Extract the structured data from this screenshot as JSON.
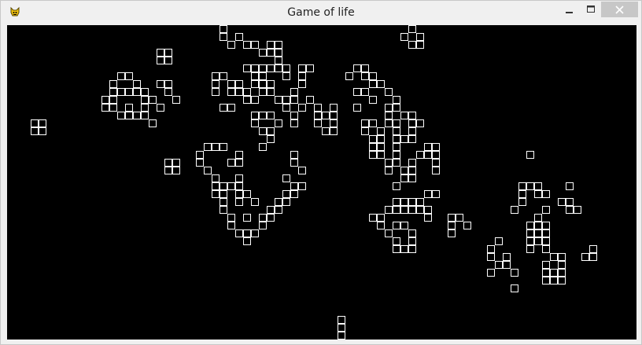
{
  "window": {
    "title": "Game of life",
    "icon": "pygame-snake-icon",
    "controls": [
      "minimize-icon",
      "maximize-icon",
      "close-icon"
    ]
  },
  "game": {
    "background_color": "#000000",
    "cell_color": "#ffffff",
    "cell_size": 10,
    "columns": 80,
    "rows": 40,
    "live_cells": [
      [
        27,
        0
      ],
      [
        51,
        0
      ],
      [
        27,
        1
      ],
      [
        29,
        1
      ],
      [
        50,
        1
      ],
      [
        52,
        1
      ],
      [
        28,
        2
      ],
      [
        30,
        2
      ],
      [
        31,
        2
      ],
      [
        33,
        2
      ],
      [
        34,
        2
      ],
      [
        51,
        2
      ],
      [
        52,
        2
      ],
      [
        19,
        3
      ],
      [
        20,
        3
      ],
      [
        32,
        3
      ],
      [
        33,
        3
      ],
      [
        34,
        3
      ],
      [
        19,
        4
      ],
      [
        20,
        4
      ],
      [
        34,
        4
      ],
      [
        33,
        5
      ],
      [
        34,
        5
      ],
      [
        30,
        5
      ],
      [
        31,
        5
      ],
      [
        32,
        5
      ],
      [
        35,
        5
      ],
      [
        37,
        5
      ],
      [
        38,
        5
      ],
      [
        44,
        5
      ],
      [
        45,
        5
      ],
      [
        14,
        6
      ],
      [
        15,
        6
      ],
      [
        26,
        6
      ],
      [
        27,
        6
      ],
      [
        31,
        6
      ],
      [
        32,
        6
      ],
      [
        35,
        6
      ],
      [
        37,
        6
      ],
      [
        43,
        6
      ],
      [
        45,
        6
      ],
      [
        46,
        6
      ],
      [
        13,
        7
      ],
      [
        16,
        7
      ],
      [
        19,
        7
      ],
      [
        20,
        7
      ],
      [
        26,
        7
      ],
      [
        28,
        7
      ],
      [
        29,
        7
      ],
      [
        31,
        7
      ],
      [
        32,
        7
      ],
      [
        33,
        7
      ],
      [
        37,
        7
      ],
      [
        46,
        7
      ],
      [
        47,
        7
      ],
      [
        13,
        8
      ],
      [
        14,
        8
      ],
      [
        15,
        8
      ],
      [
        16,
        8
      ],
      [
        17,
        8
      ],
      [
        20,
        8
      ],
      [
        26,
        8
      ],
      [
        28,
        8
      ],
      [
        29,
        8
      ],
      [
        30,
        8
      ],
      [
        32,
        8
      ],
      [
        33,
        8
      ],
      [
        36,
        8
      ],
      [
        44,
        8
      ],
      [
        45,
        8
      ],
      [
        48,
        8
      ],
      [
        12,
        9
      ],
      [
        13,
        9
      ],
      [
        17,
        9
      ],
      [
        18,
        9
      ],
      [
        21,
        9
      ],
      [
        30,
        9
      ],
      [
        31,
        9
      ],
      [
        34,
        9
      ],
      [
        35,
        9
      ],
      [
        36,
        9
      ],
      [
        38,
        9
      ],
      [
        46,
        9
      ],
      [
        49,
        9
      ],
      [
        12,
        10
      ],
      [
        13,
        10
      ],
      [
        15,
        10
      ],
      [
        17,
        10
      ],
      [
        19,
        10
      ],
      [
        27,
        10
      ],
      [
        28,
        10
      ],
      [
        35,
        10
      ],
      [
        37,
        10
      ],
      [
        39,
        10
      ],
      [
        41,
        10
      ],
      [
        44,
        10
      ],
      [
        48,
        10
      ],
      [
        49,
        10
      ],
      [
        14,
        11
      ],
      [
        15,
        11
      ],
      [
        16,
        11
      ],
      [
        17,
        11
      ],
      [
        31,
        11
      ],
      [
        32,
        11
      ],
      [
        33,
        11
      ],
      [
        36,
        11
      ],
      [
        39,
        11
      ],
      [
        40,
        11
      ],
      [
        41,
        11
      ],
      [
        48,
        11
      ],
      [
        50,
        11
      ],
      [
        51,
        11
      ],
      [
        18,
        12
      ],
      [
        31,
        12
      ],
      [
        34,
        12
      ],
      [
        36,
        12
      ],
      [
        39,
        12
      ],
      [
        41,
        12
      ],
      [
        45,
        12
      ],
      [
        46,
        12
      ],
      [
        48,
        12
      ],
      [
        49,
        12
      ],
      [
        51,
        12
      ],
      [
        52,
        12
      ],
      [
        3,
        12
      ],
      [
        4,
        12
      ],
      [
        3,
        13
      ],
      [
        4,
        13
      ],
      [
        40,
        13
      ],
      [
        41,
        13
      ],
      [
        32,
        13
      ],
      [
        33,
        13
      ],
      [
        45,
        13
      ],
      [
        47,
        13
      ],
      [
        49,
        13
      ],
      [
        51,
        13
      ],
      [
        33,
        14
      ],
      [
        46,
        14
      ],
      [
        47,
        14
      ],
      [
        49,
        14
      ],
      [
        50,
        14
      ],
      [
        51,
        14
      ],
      [
        25,
        15
      ],
      [
        26,
        15
      ],
      [
        27,
        15
      ],
      [
        32,
        15
      ],
      [
        46,
        15
      ],
      [
        47,
        15
      ],
      [
        49,
        15
      ],
      [
        53,
        15
      ],
      [
        54,
        15
      ],
      [
        24,
        16
      ],
      [
        29,
        16
      ],
      [
        36,
        16
      ],
      [
        46,
        16
      ],
      [
        47,
        16
      ],
      [
        49,
        16
      ],
      [
        52,
        16
      ],
      [
        53,
        16
      ],
      [
        54,
        16
      ],
      [
        66,
        16
      ],
      [
        20,
        17
      ],
      [
        21,
        17
      ],
      [
        24,
        17
      ],
      [
        28,
        17
      ],
      [
        29,
        17
      ],
      [
        36,
        17
      ],
      [
        48,
        17
      ],
      [
        49,
        17
      ],
      [
        51,
        17
      ],
      [
        54,
        17
      ],
      [
        20,
        18
      ],
      [
        21,
        18
      ],
      [
        25,
        18
      ],
      [
        37,
        18
      ],
      [
        48,
        18
      ],
      [
        50,
        18
      ],
      [
        51,
        18
      ],
      [
        54,
        18
      ],
      [
        26,
        19
      ],
      [
        29,
        19
      ],
      [
        35,
        19
      ],
      [
        50,
        19
      ],
      [
        51,
        19
      ],
      [
        26,
        20
      ],
      [
        27,
        20
      ],
      [
        28,
        20
      ],
      [
        29,
        20
      ],
      [
        36,
        20
      ],
      [
        37,
        20
      ],
      [
        49,
        20
      ],
      [
        65,
        20
      ],
      [
        66,
        20
      ],
      [
        67,
        20
      ],
      [
        71,
        20
      ],
      [
        26,
        21
      ],
      [
        27,
        21
      ],
      [
        29,
        21
      ],
      [
        30,
        21
      ],
      [
        35,
        21
      ],
      [
        36,
        21
      ],
      [
        53,
        21
      ],
      [
        54,
        21
      ],
      [
        65,
        21
      ],
      [
        67,
        21
      ],
      [
        68,
        21
      ],
      [
        27,
        22
      ],
      [
        29,
        22
      ],
      [
        31,
        22
      ],
      [
        34,
        22
      ],
      [
        35,
        22
      ],
      [
        49,
        22
      ],
      [
        50,
        22
      ],
      [
        51,
        22
      ],
      [
        52,
        22
      ],
      [
        65,
        22
      ],
      [
        70,
        22
      ],
      [
        71,
        22
      ],
      [
        27,
        23
      ],
      [
        33,
        23
      ],
      [
        34,
        23
      ],
      [
        48,
        23
      ],
      [
        49,
        23
      ],
      [
        50,
        23
      ],
      [
        51,
        23
      ],
      [
        52,
        23
      ],
      [
        53,
        23
      ],
      [
        64,
        23
      ],
      [
        68,
        23
      ],
      [
        71,
        23
      ],
      [
        72,
        23
      ],
      [
        28,
        24
      ],
      [
        30,
        24
      ],
      [
        32,
        24
      ],
      [
        33,
        24
      ],
      [
        46,
        24
      ],
      [
        47,
        24
      ],
      [
        53,
        24
      ],
      [
        56,
        24
      ],
      [
        57,
        24
      ],
      [
        67,
        24
      ],
      [
        28,
        25
      ],
      [
        32,
        25
      ],
      [
        47,
        25
      ],
      [
        49,
        25
      ],
      [
        50,
        25
      ],
      [
        56,
        25
      ],
      [
        58,
        25
      ],
      [
        66,
        25
      ],
      [
        67,
        25
      ],
      [
        68,
        25
      ],
      [
        29,
        26
      ],
      [
        30,
        26
      ],
      [
        31,
        26
      ],
      [
        48,
        26
      ],
      [
        51,
        26
      ],
      [
        56,
        26
      ],
      [
        66,
        26
      ],
      [
        67,
        26
      ],
      [
        68,
        26
      ],
      [
        30,
        27
      ],
      [
        49,
        27
      ],
      [
        51,
        27
      ],
      [
        62,
        27
      ],
      [
        66,
        27
      ],
      [
        67,
        27
      ],
      [
        68,
        27
      ],
      [
        49,
        28
      ],
      [
        50,
        28
      ],
      [
        51,
        28
      ],
      [
        61,
        28
      ],
      [
        66,
        28
      ],
      [
        68,
        28
      ],
      [
        74,
        28
      ],
      [
        61,
        29
      ],
      [
        63,
        29
      ],
      [
        69,
        29
      ],
      [
        70,
        29
      ],
      [
        73,
        29
      ],
      [
        74,
        29
      ],
      [
        62,
        30
      ],
      [
        63,
        30
      ],
      [
        68,
        30
      ],
      [
        70,
        30
      ],
      [
        61,
        31
      ],
      [
        64,
        31
      ],
      [
        68,
        31
      ],
      [
        69,
        31
      ],
      [
        70,
        31
      ],
      [
        68,
        32
      ],
      [
        69,
        32
      ],
      [
        70,
        32
      ],
      [
        64,
        33
      ],
      [
        42,
        37
      ],
      [
        42,
        38
      ],
      [
        42,
        39
      ]
    ]
  }
}
